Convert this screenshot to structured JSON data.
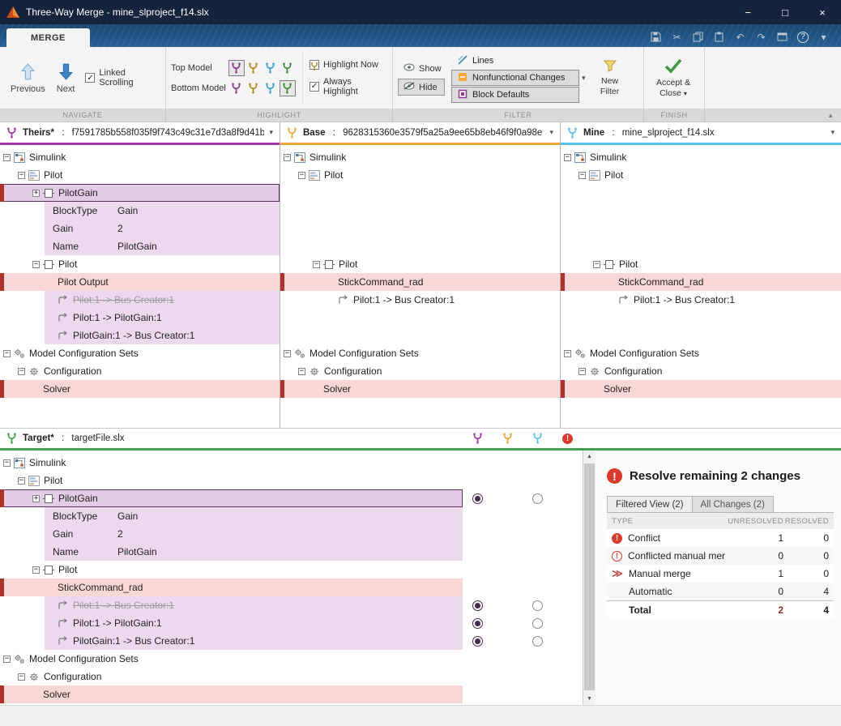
{
  "window": {
    "title": "Three-Way Merge - mine_slproject_f14.slx",
    "minimize": "−",
    "maximize": "□",
    "close": "×"
  },
  "ribbon": {
    "tab": "MERGE",
    "sections": {
      "navigate": {
        "label": "NAVIGATE",
        "previous": "Previous",
        "next": "Next",
        "linked_scrolling": "Linked Scrolling"
      },
      "highlight": {
        "label": "HIGHLIGHT",
        "top_model": "Top Model",
        "bottom_model": "Bottom Model",
        "highlight_now": "Highlight Now",
        "always_highlight": "Always Highlight"
      },
      "filter": {
        "label": "FILTER",
        "show": "Show",
        "hide": "Hide",
        "filters": [
          "Lines",
          "Nonfunctional Changes",
          "Block Defaults"
        ],
        "new_filter": "New Filter"
      },
      "finish": {
        "label": "FINISH",
        "accept_close": "Accept & Close"
      }
    }
  },
  "colors": {
    "theirs_accent": "#a235a8",
    "base_accent": "#eda73f",
    "mine_accent": "#57c4f0",
    "target_accent": "#46a049",
    "conflict_red": "#d83b2e",
    "change_marker_red": "#ad342b",
    "hl_purple": "#8b3a8f",
    "hl_yellow": "#b08c1e",
    "hl_blue": "#3f9fd0",
    "hl_green": "#3f8f3f",
    "selected_purple_bg": "#e3cce5",
    "change_purple_bg": "#ecd9ee",
    "change_pink_bg": "#f9d7d4"
  },
  "panels": {
    "theirs": {
      "title": "Theirs*",
      "sep": " : ",
      "value": "f7591785b558f035f9f743c49c31e7d3a8f9d41b"
    },
    "base": {
      "title": "Base",
      "sep": " : ",
      "value": "9628315360e3579f5a25a9ee65b8eb46f9f0a98e"
    },
    "mine": {
      "title": "Mine",
      "sep": " : ",
      "value": "mine_slproject_f14.slx"
    },
    "target": {
      "title": "Target*",
      "sep": " : ",
      "value": "targetFile.slx"
    }
  },
  "trees": {
    "theirs": [
      {
        "indent": 0,
        "expand": "-",
        "icon": "simulink",
        "label": "Simulink"
      },
      {
        "indent": 1,
        "expand": "-",
        "icon": "subsystem",
        "label": "Pilot"
      },
      {
        "indent": 2,
        "expand": "+",
        "icon": "block",
        "label": "PilotGain",
        "style": "selected",
        "red": true
      },
      {
        "indent": 3,
        "label": "BlockType",
        "value": "Gain",
        "style": "prop"
      },
      {
        "indent": 3,
        "label": "Gain",
        "value": "2",
        "style": "prop"
      },
      {
        "indent": 3,
        "label": "Name",
        "value": "PilotGain",
        "style": "prop"
      },
      {
        "indent": 2,
        "expand": "-",
        "icon": "block",
        "label": "Pilot"
      },
      {
        "indent": 3,
        "label": "Pilot Output",
        "style": "pink",
        "red": true
      },
      {
        "indent": 3,
        "icon": "line",
        "label": "Pilot:1 -> Bus Creator:1",
        "style": "strike"
      },
      {
        "indent": 3,
        "icon": "line",
        "label": "Pilot:1 -> PilotGain:1",
        "style": "purple"
      },
      {
        "indent": 3,
        "icon": "line",
        "label": "PilotGain:1 -> Bus Creator:1",
        "style": "purple"
      },
      {
        "indent": 0,
        "expand": "-",
        "icon": "configs",
        "label": "Model Configuration Sets"
      },
      {
        "indent": 1,
        "expand": "-",
        "icon": "config",
        "label": "Configuration"
      },
      {
        "indent": 2,
        "label": "Solver",
        "style": "pink",
        "red": true
      }
    ],
    "base": [
      {
        "indent": 0,
        "expand": "-",
        "icon": "simulink",
        "label": "Simulink"
      },
      {
        "indent": 1,
        "expand": "-",
        "icon": "subsystem",
        "label": "Pilot"
      },
      {
        "style": "spacer"
      },
      {
        "style": "spacer"
      },
      {
        "style": "spacer"
      },
      {
        "style": "spacer"
      },
      {
        "indent": 2,
        "expand": "-",
        "icon": "block",
        "label": "Pilot"
      },
      {
        "indent": 3,
        "label": "StickCommand_rad",
        "style": "pink",
        "red": true
      },
      {
        "indent": 3,
        "icon": "line",
        "label": "Pilot:1 -> Bus Creator:1"
      },
      {
        "style": "spacer"
      },
      {
        "style": "spacer"
      },
      {
        "indent": 0,
        "expand": "-",
        "icon": "configs",
        "label": "Model Configuration Sets"
      },
      {
        "indent": 1,
        "expand": "-",
        "icon": "config",
        "label": "Configuration"
      },
      {
        "indent": 2,
        "label": "Solver",
        "style": "pink",
        "red": true
      }
    ],
    "mine": [
      {
        "indent": 0,
        "expand": "-",
        "icon": "simulink",
        "label": "Simulink"
      },
      {
        "indent": 1,
        "expand": "-",
        "icon": "subsystem",
        "label": "Pilot"
      },
      {
        "style": "spacer"
      },
      {
        "style": "spacer"
      },
      {
        "style": "spacer"
      },
      {
        "style": "spacer"
      },
      {
        "indent": 2,
        "expand": "-",
        "icon": "block",
        "label": "Pilot"
      },
      {
        "indent": 3,
        "label": "StickCommand_rad",
        "style": "pink",
        "red": true
      },
      {
        "indent": 3,
        "icon": "line",
        "label": "Pilot:1 -> Bus Creator:1"
      },
      {
        "style": "spacer"
      },
      {
        "style": "spacer"
      },
      {
        "indent": 0,
        "expand": "-",
        "icon": "configs",
        "label": "Model Configuration Sets"
      },
      {
        "indent": 1,
        "expand": "-",
        "icon": "config",
        "label": "Configuration"
      },
      {
        "indent": 2,
        "label": "Solver",
        "style": "pink",
        "red": true
      }
    ],
    "target": [
      {
        "indent": 0,
        "expand": "-",
        "icon": "simulink",
        "label": "Simulink"
      },
      {
        "indent": 1,
        "expand": "-",
        "icon": "subsystem",
        "label": "Pilot"
      },
      {
        "indent": 2,
        "expand": "+",
        "icon": "block",
        "label": "PilotGain",
        "style": "selected",
        "red": true,
        "r1": "sel",
        "r3": "unsel"
      },
      {
        "indent": 3,
        "label": "BlockType",
        "value": "Gain",
        "style": "prop"
      },
      {
        "indent": 3,
        "label": "Gain",
        "value": "2",
        "style": "prop"
      },
      {
        "indent": 3,
        "label": "Name",
        "value": "PilotGain",
        "style": "prop"
      },
      {
        "indent": 2,
        "expand": "-",
        "icon": "block",
        "label": "Pilot"
      },
      {
        "indent": 3,
        "label": "StickCommand_rad",
        "style": "pink",
        "red": true
      },
      {
        "indent": 3,
        "icon": "line",
        "label": "Pilot:1 -> Bus Creator:1",
        "style": "strike",
        "r1": "sel",
        "r3": "unsel"
      },
      {
        "indent": 3,
        "icon": "line",
        "label": "Pilot:1 -> PilotGain:1",
        "style": "purple",
        "r1": "sel",
        "r3": "unsel"
      },
      {
        "indent": 3,
        "icon": "line",
        "label": "PilotGain:1 -> Bus Creator:1",
        "style": "purple",
        "r1": "sel",
        "r3": "unsel"
      },
      {
        "indent": 0,
        "expand": "-",
        "icon": "configs",
        "label": "Model Configuration Sets"
      },
      {
        "indent": 1,
        "expand": "-",
        "icon": "config",
        "label": "Configuration"
      },
      {
        "indent": 2,
        "label": "Solver",
        "style": "pink",
        "red": true
      }
    ]
  },
  "resolve": {
    "title": "Resolve remaining 2 changes",
    "tabs": [
      {
        "label": "Filtered View (2)",
        "active": true
      },
      {
        "label": "All Changes (2)",
        "active": false
      }
    ],
    "table": {
      "headers": [
        "TYPE",
        "UNRESOLVED",
        "RESOLVED"
      ],
      "rows": [
        {
          "icon": "conflict",
          "type": "Conflict",
          "unresolved": "1",
          "resolved": "0"
        },
        {
          "icon": "conflicted-manual-merge",
          "type": "Conflicted manual merge",
          "unresolved": "0",
          "resolved": "0"
        },
        {
          "icon": "manual-merge",
          "type": "Manual merge",
          "unresolved": "1",
          "resolved": "0"
        },
        {
          "icon": "",
          "type": "Automatic",
          "unresolved": "0",
          "resolved": "4"
        },
        {
          "icon": "",
          "type": "Total",
          "unresolved": "2",
          "resolved": "4",
          "total": true
        }
      ]
    }
  }
}
